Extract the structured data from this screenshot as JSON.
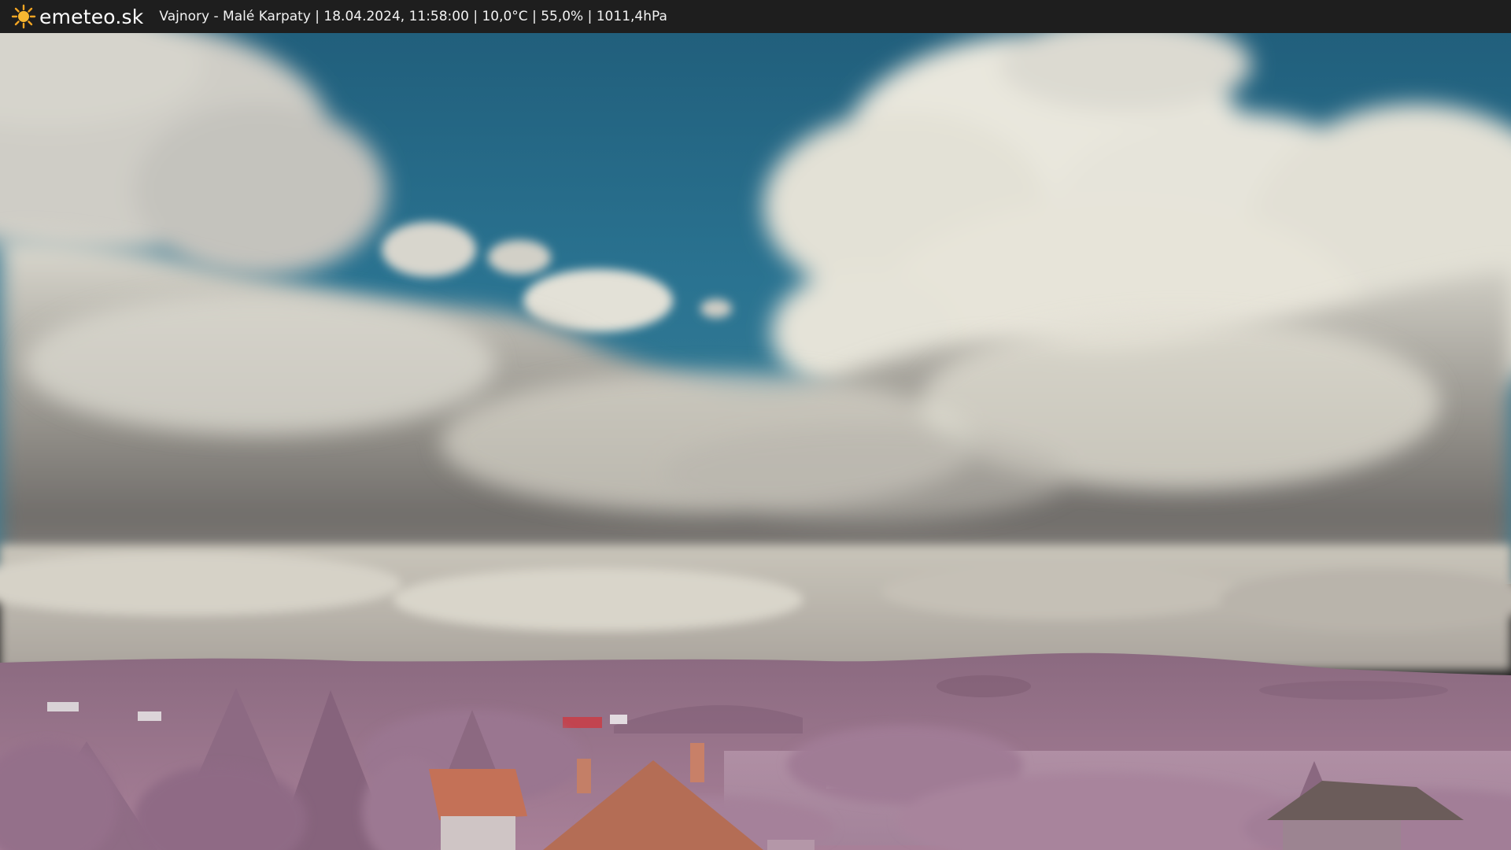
{
  "header": {
    "brand": "emeteo.sk",
    "logo_icon": "sun-icon",
    "caption": "Vajnory - Malé Karpaty | 18.04.2024, 11:58:00 | 10,0°C | 55,0% | 1011,4hPa"
  },
  "colors": {
    "bar": "#1e1e1e",
    "sun": "#f5a623",
    "sky": "#266c88",
    "cloud": "#e8e6dc",
    "vegetation": "#a27a97",
    "roof": "#c07558"
  }
}
